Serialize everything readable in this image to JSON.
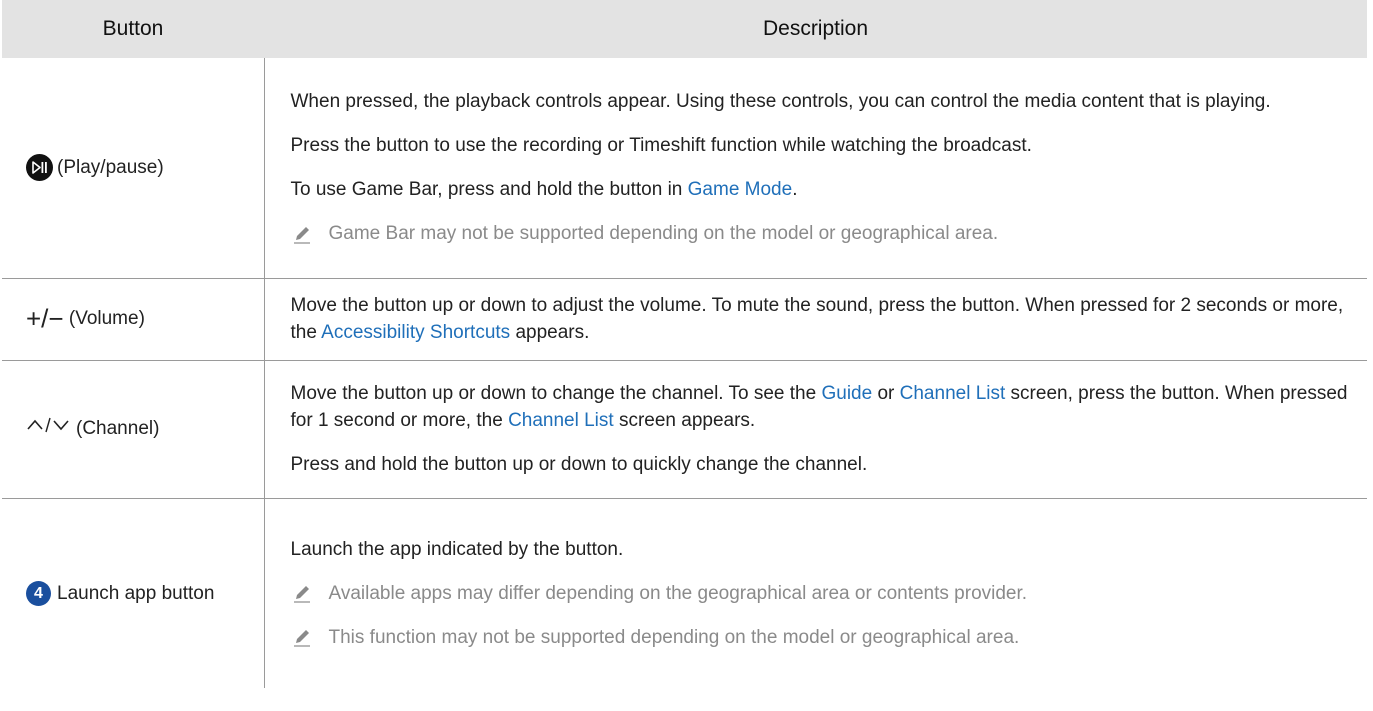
{
  "table": {
    "headers": [
      "Button",
      "Description"
    ],
    "rows": [
      {
        "button_label": "(Play/pause)",
        "icon": "play-pause-icon",
        "desc": {
          "p1": "When pressed, the playback controls appear. Using these controls, you can control the media content that is playing.",
          "p2": "Press the button to use the recording or Timeshift function while watching the broadcast.",
          "p3_pre": "To use Game Bar, press and hold the button in ",
          "p3_link": "Game Mode",
          "p3_post": ".",
          "note": "Game Bar may not be supported depending on the model or geographical area."
        }
      },
      {
        "button_label": "(Volume)",
        "icon": "plus-minus-icon",
        "symbol": "+/−",
        "desc": {
          "pre": "Move the button up or down to adjust the volume. To mute the sound, press the button. When pressed for 2 seconds or more, the ",
          "link": "Accessibility Shortcuts",
          "post": " appears."
        }
      },
      {
        "button_label": "(Channel)",
        "icon": "up-down-chevron-icon",
        "desc": {
          "p1_pre": "Move the button up or down to change the channel. To see the ",
          "p1_link1": "Guide",
          "p1_mid1": " or ",
          "p1_link2": "Channel List",
          "p1_mid2": " screen, press the button. When pressed for 1 second or more, the ",
          "p1_link3": "Channel List",
          "p1_post": " screen appears.",
          "p2": "Press and hold the button up or down to quickly change the channel."
        }
      },
      {
        "button_label": "Launch app button",
        "icon": "number-4-icon",
        "icon_text": "4",
        "desc": {
          "p1": "Launch the app indicated by the button.",
          "note1": "Available apps may differ depending on the geographical area or contents provider.",
          "note2": "This function may not be supported depending on the model or geographical area."
        }
      }
    ]
  },
  "colors": {
    "header_bg": "#e3e3e3",
    "link": "#1f6fb9",
    "note_text": "#8a8a8a",
    "badge": "#1a4f9e"
  }
}
